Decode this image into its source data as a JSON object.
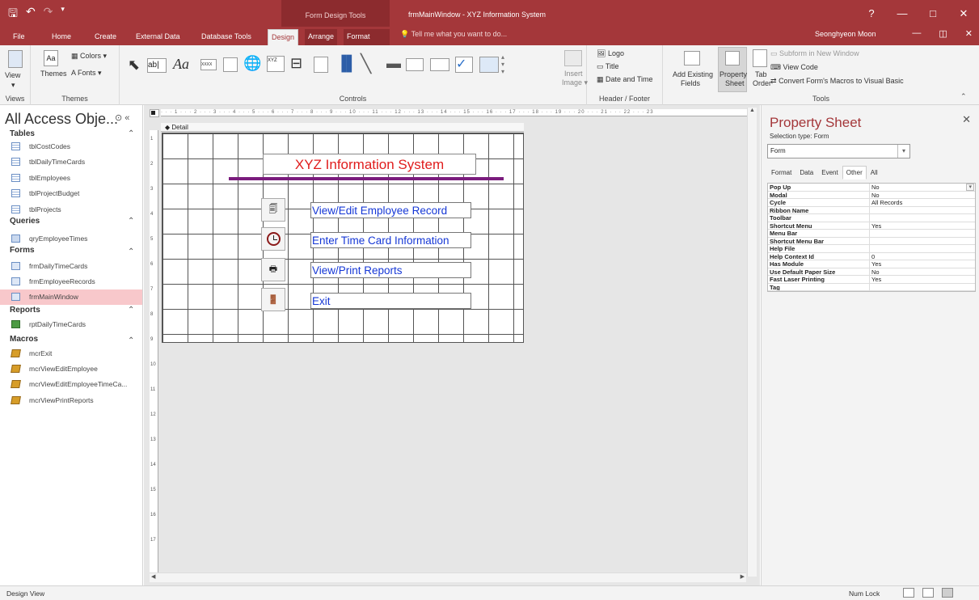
{
  "title_bar": {
    "contextual_label": "Form Design Tools",
    "app_title": "frmMainWindow - XYZ Information System",
    "help": "?",
    "minimize": "—",
    "restore": "□",
    "close": "✕"
  },
  "tabs": {
    "file": "File",
    "home": "Home",
    "create": "Create",
    "external": "External Data",
    "dbtools": "Database Tools",
    "design": "Design",
    "arrange": "Arrange",
    "format": "Format",
    "tell_me": "Tell me what you want to do...",
    "user": "Seonghyeon Moon"
  },
  "ribbon": {
    "views_group": "Views",
    "view_btn": "View",
    "themes_group": "Themes",
    "themes_btn": "Themes",
    "colors_btn": "Colors",
    "fonts_btn": "Fonts",
    "controls_group": "Controls",
    "insert_image": "Insert",
    "insert_image2": "Image",
    "header_group": "Header / Footer",
    "logo": "Logo",
    "title": "Title",
    "date_time": "Date and Time",
    "tools_group": "Tools",
    "add_fields": "Add Existing",
    "add_fields2": "Fields",
    "property_sheet": "Property",
    "property_sheet2": "Sheet",
    "tab_order": "Tab",
    "tab_order2": "Order",
    "subform": "Subform in New Window",
    "view_code": "View Code",
    "convert_macros": "Convert Form's Macros to Visual Basic"
  },
  "nav": {
    "title": "All Access Obje...",
    "tables_header": "Tables",
    "tables": [
      "tblCostCodes",
      "tblDailyTimeCards",
      "tblEmployees",
      "tblProjectBudget",
      "tblProjects"
    ],
    "queries_header": "Queries",
    "queries": [
      "qryEmployeeTimes"
    ],
    "forms_header": "Forms",
    "forms": [
      "frmDailyTimeCards",
      "frmEmployeeRecords",
      "frmMainWindow"
    ],
    "reports_header": "Reports",
    "reports": [
      "rptDailyTimeCards"
    ],
    "macros_header": "Macros",
    "macros": [
      "mcrExit",
      "mcrViewEditEmployee",
      "mcrViewEditEmployeeTimeCa...",
      "mcrViewPrintReports"
    ]
  },
  "form": {
    "section": "Detail",
    "title": "XYZ Information System",
    "labels": [
      "View/Edit Employee Record",
      "Enter Time Card Information",
      "View/Print Reports",
      "Exit"
    ],
    "ruler_numbers": [
      "1",
      "2",
      "3",
      "4",
      "5",
      "6",
      "7",
      "8",
      "9",
      "10",
      "11",
      "12",
      "13",
      "14",
      "15",
      "16",
      "17"
    ]
  },
  "property_sheet": {
    "title": "Property Sheet",
    "selection_type": "Selection type:  Form",
    "selected": "Form",
    "tabs": [
      "Format",
      "Data",
      "Event",
      "Other",
      "All"
    ],
    "active_tab": "Other",
    "rows": [
      {
        "name": "Pop Up",
        "value": "No"
      },
      {
        "name": "Modal",
        "value": "No"
      },
      {
        "name": "Cycle",
        "value": "All Records"
      },
      {
        "name": "Ribbon Name",
        "value": ""
      },
      {
        "name": "Toolbar",
        "value": ""
      },
      {
        "name": "Shortcut Menu",
        "value": "Yes"
      },
      {
        "name": "Menu Bar",
        "value": ""
      },
      {
        "name": "Shortcut Menu Bar",
        "value": ""
      },
      {
        "name": "Help File",
        "value": ""
      },
      {
        "name": "Help Context Id",
        "value": "0"
      },
      {
        "name": "Has Module",
        "value": "Yes"
      },
      {
        "name": "Use Default Paper Size",
        "value": "No"
      },
      {
        "name": "Fast Laser Printing",
        "value": "Yes"
      },
      {
        "name": "Tag",
        "value": ""
      }
    ]
  },
  "status": {
    "mode": "Design View",
    "num_lock": "Num Lock"
  },
  "colors": {
    "accent": "#a4373a",
    "form_title": "#e01d1d",
    "link_label": "#1537d6",
    "title_line": "#7a1c7d",
    "nav_selected": "#f8c8cb"
  }
}
